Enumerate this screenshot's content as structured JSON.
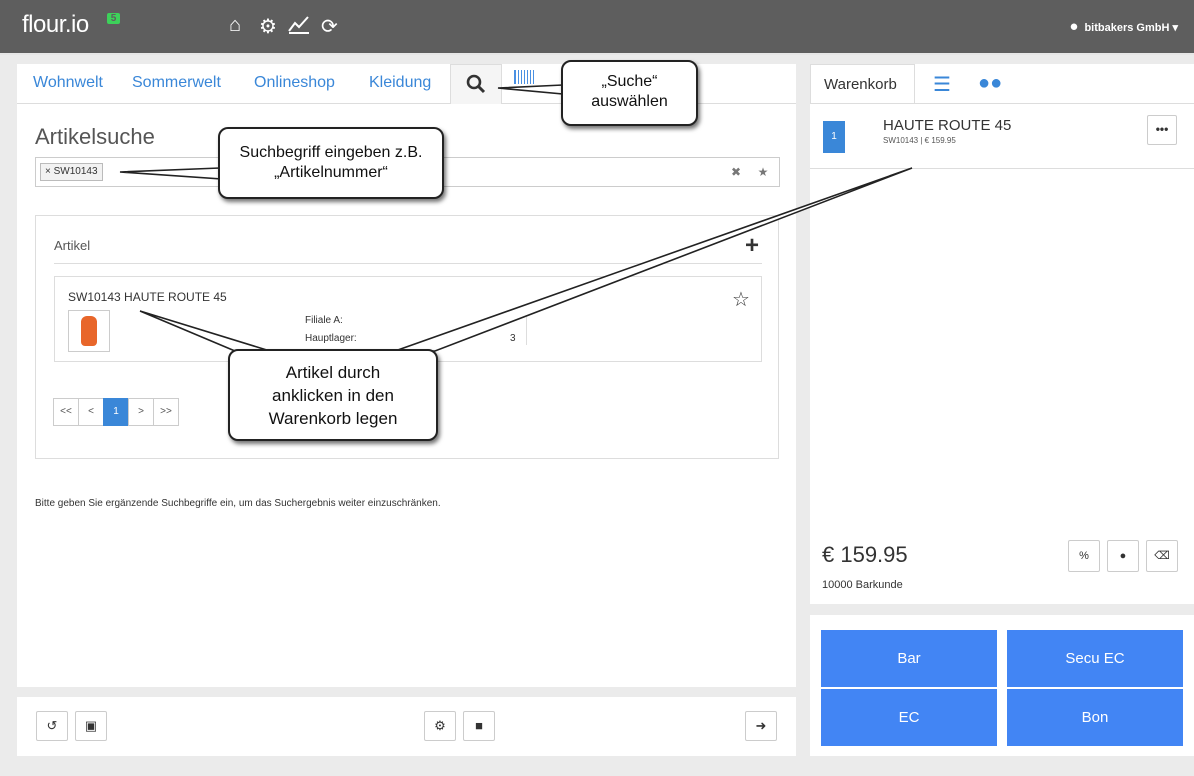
{
  "topbar": {
    "logo": "flour.io",
    "logo_badge": "5",
    "user": "bitbakers GmbH",
    "icons": [
      "home-icon",
      "gear-icon",
      "chart-icon",
      "refresh-icon"
    ]
  },
  "tabs": [
    "Wohnwelt",
    "Sommerwelt",
    "Onlineshop",
    "Kleidung"
  ],
  "search": {
    "title": "Artikelsuche",
    "tag": "SW10143",
    "tag_close": "×"
  },
  "artikel": {
    "header": "Artikel",
    "item_title": "SW10143 HAUTE ROUTE 45",
    "stock_a": "Filiale A:",
    "stock_b": "Hauptlager:",
    "stock_b_value": "3"
  },
  "pager": [
    "<<",
    "<",
    "1",
    ">",
    ">>"
  ],
  "hint": "Bitte geben Sie ergänzende Suchbegriffe ein, um das Suchergebnis weiter einzuschränken.",
  "cart": {
    "tab": "Warenkorb",
    "qty": "1",
    "name": "HAUTE ROUTE 45",
    "sub": "SW10143 | € 159.95",
    "more": "•••",
    "total": "€ 159.95",
    "customer": "10000 Barkunde",
    "discount": "%"
  },
  "payment": {
    "bar": "Bar",
    "secu_ec": "Secu EC",
    "ec": "EC",
    "bon": "Bon"
  },
  "callouts": {
    "suche": "„Suche“ auswählen",
    "suchbegriff": "Suchbegriff eingeben z.B. „Artikelnummer“",
    "artikel": "Artikel durch anklicken in den Warenkorb legen"
  },
  "colors": {
    "topbar": "#5e5e5e",
    "accent": "#3a87d8",
    "pay": "#4285f4",
    "badge": "#3dd15a"
  }
}
